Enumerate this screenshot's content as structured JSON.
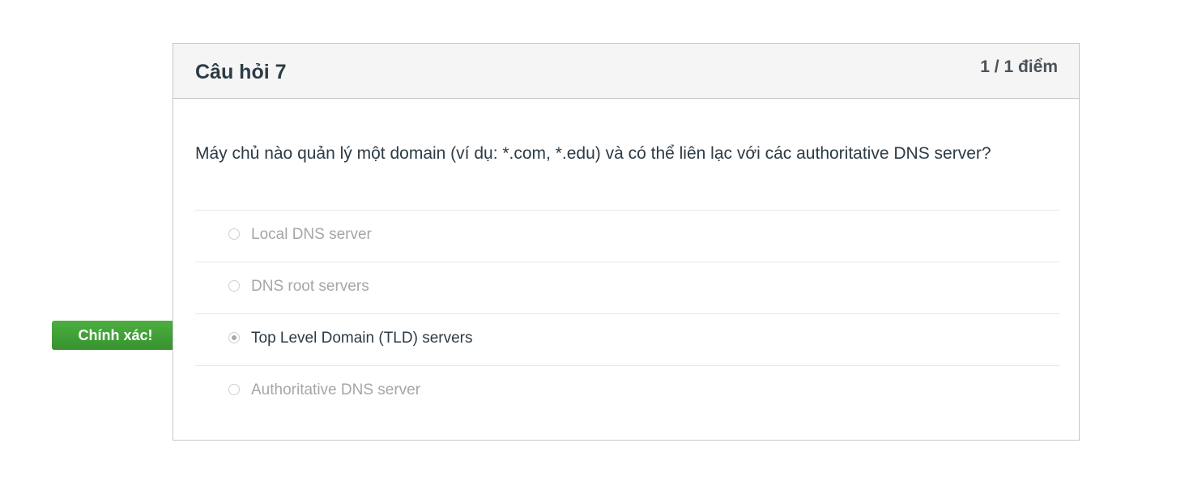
{
  "question": {
    "title": "Câu hỏi 7",
    "score": "1 / 1 điểm",
    "text": "Máy chủ nào quản lý một domain (ví dụ: *.com, *.edu) và có thể liên lạc với các authoritative DNS server?"
  },
  "answers": [
    {
      "label": "Local DNS server",
      "selected": false
    },
    {
      "label": "DNS root servers",
      "selected": false
    },
    {
      "label": "Top Level Domain (TLD) servers",
      "selected": true
    },
    {
      "label": "Authoritative DNS server",
      "selected": false
    }
  ],
  "result_flag": {
    "label": "Chính xác!",
    "color": "#3c9d3c"
  }
}
